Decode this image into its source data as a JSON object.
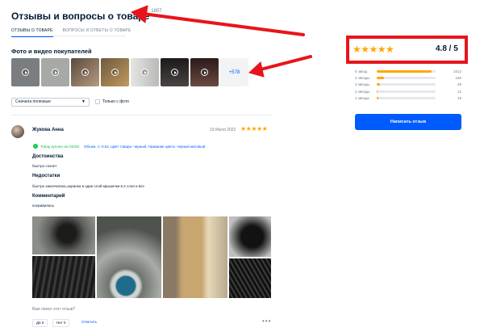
{
  "header": {
    "title": "Отзывы и вопросы о товаре",
    "count": "1857"
  },
  "tabs": [
    {
      "label": "ОТЗЫВЫ О ТОВАРЕ"
    },
    {
      "label": "ВОПРОСЫ И ОТВЕТЫ О ТОВАРЕ"
    }
  ],
  "photos": {
    "heading": "Фото и видео покупателей",
    "thumbs": [
      {
        "color": "#7b7e80",
        "video": true
      },
      {
        "color": "#a7a9a6",
        "video": true
      },
      {
        "color": "#6d5a4c",
        "video": true
      },
      {
        "color": "#9b7a54",
        "video": true
      },
      {
        "color": "#cfd0cd",
        "video": true
      },
      {
        "color": "#2f2b2b",
        "video": true
      },
      {
        "color": "#3a2725",
        "video": true
      }
    ],
    "more": "+578"
  },
  "filters": {
    "sort": "Сначала полезные",
    "only_photo": "Только с фото"
  },
  "review": {
    "author": "Жукова Анна",
    "date": "19 Июля 2022",
    "stars": "★★★★★",
    "verified": "Товар куплен на OZON",
    "variant": "Объем, л: 0.52, Цвет товара: черный, Название цвета: черный матовый",
    "pros_h": "Достоинства",
    "pros": "быстро сохнет",
    "cons_h": "Недостатки",
    "cons": "быстро закончилась,коранка в один слой крышечки в 2 слоя и все",
    "comment_h": "Комментарий",
    "comment": "понравилась",
    "helpful_q": "Вам помог этот отзыв?",
    "yes": "Да 0",
    "no": "Нет 0",
    "reply": "Ответить",
    "more": "•••"
  },
  "summary": {
    "stars": "★★★★★",
    "rating": "4.8 / 5",
    "bars": [
      {
        "label": "5 звезд",
        "count": "1612",
        "fraction": 0.93
      },
      {
        "label": "4 звезды",
        "count": "166",
        "fraction": 0.13
      },
      {
        "label": "3 звезды",
        "count": "49",
        "fraction": 0.05
      },
      {
        "label": "2 звезды",
        "count": "12",
        "fraction": 0.02
      },
      {
        "label": "1 звезда",
        "count": "19",
        "fraction": 0.03
      }
    ],
    "write_button": "Написать отзыв"
  },
  "colors": {
    "accent": "#005bff",
    "star": "#ffa800",
    "annotation": "#e8141b",
    "verified": "#10c44c"
  }
}
